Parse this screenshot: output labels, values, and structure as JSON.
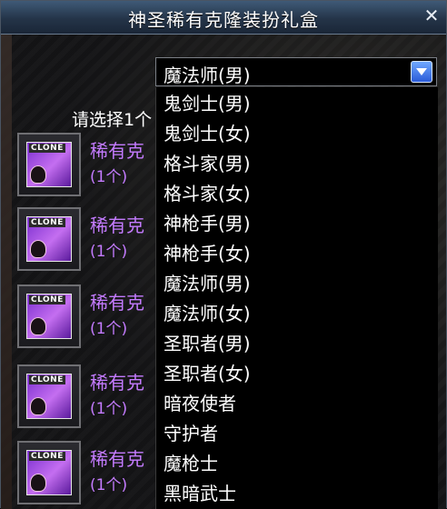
{
  "window": {
    "title": "神圣稀有克隆装扮礼盒"
  },
  "prompt_text": "请选择1个",
  "items": [
    {
      "icon_tag": "CLONE",
      "name": "稀有克",
      "count": "(1个)"
    },
    {
      "icon_tag": "CLONE",
      "name": "稀有克",
      "count": "(1个)"
    },
    {
      "icon_tag": "CLONE",
      "name": "稀有克",
      "count": "(1个)"
    },
    {
      "icon_tag": "CLONE",
      "name": "稀有克",
      "count": "(1个)"
    },
    {
      "icon_tag": "CLONE",
      "name": "稀有克",
      "count": "(1个)"
    }
  ],
  "class_select": {
    "selected": "魔法师(男)",
    "options": [
      "鬼剑士(男)",
      "鬼剑士(女)",
      "格斗家(男)",
      "格斗家(女)",
      "神枪手(男)",
      "神枪手(女)",
      "魔法师(男)",
      "魔法师(女)",
      "圣职者(男)",
      "圣职者(女)",
      "暗夜使者",
      "守护者",
      "魔枪士",
      "黑暗武士"
    ]
  },
  "colors": {
    "item_text": "#c47bff",
    "title_bar": "#2f4560",
    "dropdown_bg": "#000000"
  },
  "icons": {
    "close": "close-icon",
    "dropdown_arrow": "chevron-down-icon"
  }
}
